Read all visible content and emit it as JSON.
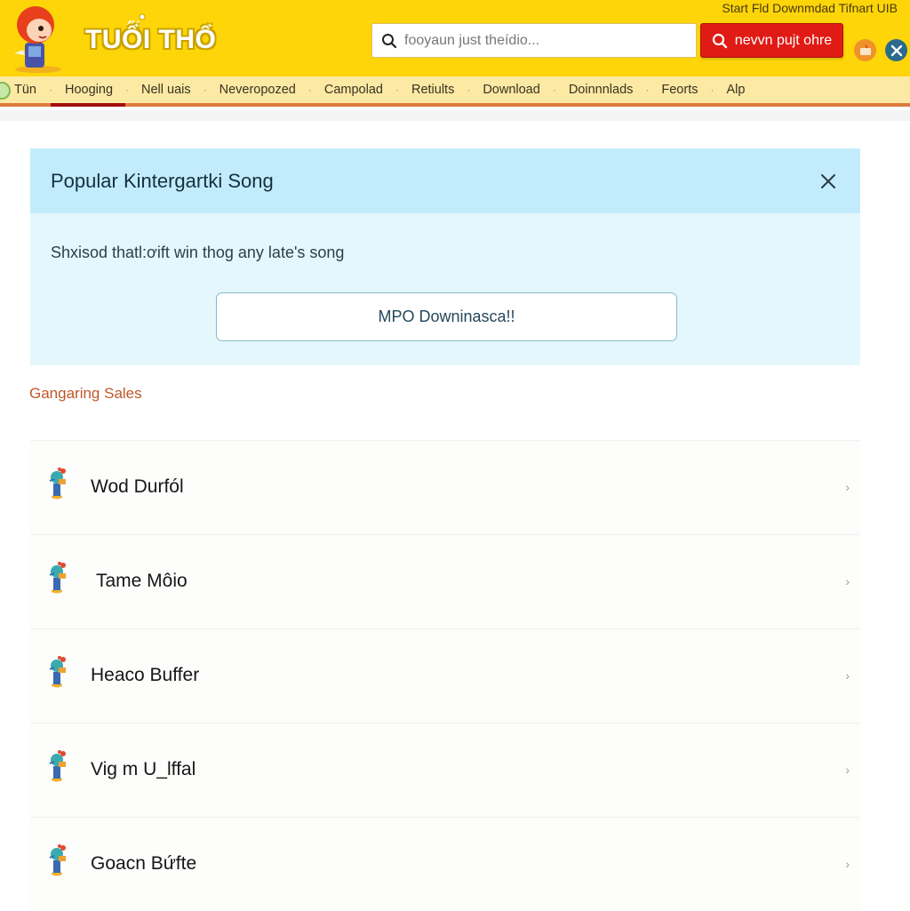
{
  "header": {
    "logo_text": "TUỔI THỔ",
    "top_links": "Start Fld Downmdad Tifnart UIB",
    "search": {
      "placeholder": "fooyaun just theídio...",
      "value": ""
    },
    "search_button_label": "nevvn pujt ohre",
    "icons": [
      "gift-icon",
      "settings-icon"
    ],
    "brand_color": "#fdd508",
    "accent_color": "#e01a14"
  },
  "nav": {
    "items": [
      {
        "label": "Tün",
        "active": false
      },
      {
        "label": "Hooging",
        "active": true
      },
      {
        "label": "Nell uais",
        "active": false
      },
      {
        "label": "Neveropozed",
        "active": false
      },
      {
        "label": "Campolad",
        "active": false
      },
      {
        "label": "Retiults",
        "active": false
      },
      {
        "label": "Download",
        "active": false
      },
      {
        "label": "Doinnnlads",
        "active": false
      },
      {
        "label": "Feorts",
        "active": false
      },
      {
        "label": "Alp",
        "active": false
      }
    ]
  },
  "card": {
    "title": "Popular Kintergartki Song",
    "text": "Shxisod thatl:ơift win thog any late's song",
    "button_label": "MPO Downinasca!!"
  },
  "section_label": "Gangaring Sales",
  "list": {
    "items": [
      {
        "label": "Wod Durfól"
      },
      {
        "label": "Tame Môio"
      },
      {
        "label": "Heaco Buffer"
      },
      {
        "label": "Vig m U_lffal"
      },
      {
        "label": "Goacn Bứfte"
      }
    ]
  }
}
